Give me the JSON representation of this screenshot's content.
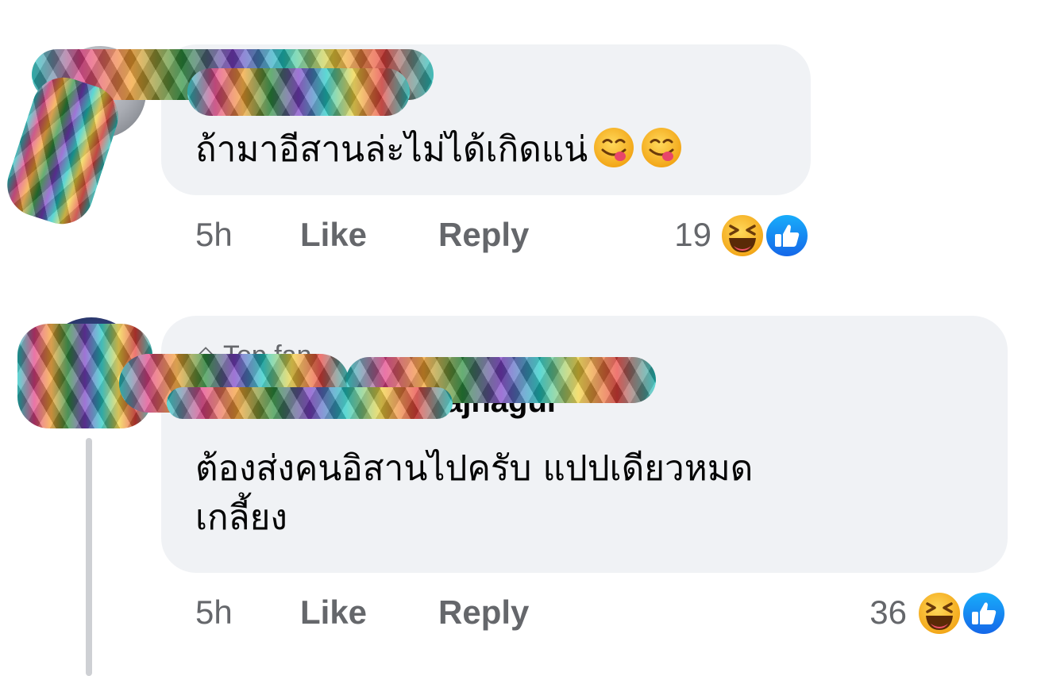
{
  "comments": [
    {
      "author": "",
      "badge": "",
      "text": "ถ้ามาอีสานล่ะไม่ได้เกิดแน่",
      "emojis": [
        "yum-face-emoji",
        "yum-face-emoji"
      ],
      "time": "5h",
      "like_label": "Like",
      "reply_label": "Reply",
      "reaction_count": "19",
      "reactions": [
        "haha-reaction",
        "like-reaction"
      ]
    },
    {
      "author": "ajnagul",
      "badge": "Top fan",
      "text_line1": "ต้องส่งคนอิสานไปครับ แปปเดียวหมด",
      "text_line2": "เกลี้ยง",
      "time": "5h",
      "like_label": "Like",
      "reply_label": "Reply",
      "reaction_count": "36",
      "reactions": [
        "haha-reaction",
        "like-reaction"
      ]
    }
  ],
  "colors": {
    "bubble": "#f0f2f5",
    "meta_text": "#65676b",
    "like_blue": "#1877f2",
    "haha_yellow": "#f7b125"
  }
}
